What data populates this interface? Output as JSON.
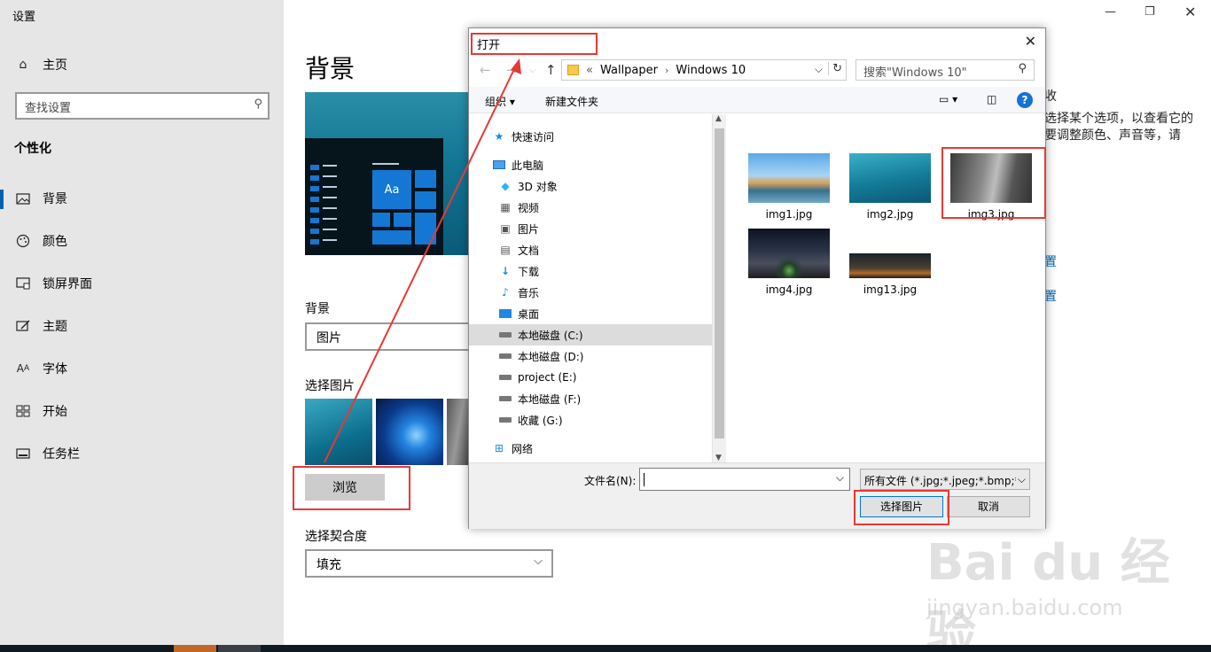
{
  "app_title": "设置",
  "sidebar": {
    "home": "主页",
    "search_placeholder": "查找设置",
    "category": "个性化",
    "items": [
      {
        "label": "背景",
        "icon": "image-icon"
      },
      {
        "label": "颜色",
        "icon": "palette-icon"
      },
      {
        "label": "锁屏界面",
        "icon": "lock-screen-icon"
      },
      {
        "label": "主题",
        "icon": "theme-icon"
      },
      {
        "label": "字体",
        "icon": "font-icon"
      },
      {
        "label": "开始",
        "icon": "start-icon"
      },
      {
        "label": "任务栏",
        "icon": "taskbar-icon"
      }
    ]
  },
  "main": {
    "title": "背景",
    "preview_tile_text": "Aa",
    "background_label": "背景",
    "background_value": "图片",
    "choose_picture_label": "选择图片",
    "browse_label": "浏览",
    "fit_label": "选择契合度",
    "fit_value": "填充",
    "right_text": [
      "收",
      "选择某个选项，以查看它的",
      "要调整颜色、声音等，请"
    ],
    "right_links": [
      "置",
      "置"
    ]
  },
  "dialog": {
    "title": "打开",
    "breadcrumb": [
      "«",
      "Wallpaper",
      "Windows 10"
    ],
    "search_placeholder": "搜索\"Windows 10\"",
    "toolbar": {
      "organize": "组织 ▾",
      "new_folder": "新建文件夹"
    },
    "tree": [
      {
        "label": "快速访问",
        "icon": "star-icon",
        "color": "#1e88e5"
      },
      {
        "label": "此电脑",
        "icon": "computer-icon",
        "color": "#1e88e5"
      },
      {
        "label": "3D 对象",
        "icon": "cube-icon",
        "color": "#29b6f6"
      },
      {
        "label": "视频",
        "icon": "video-icon",
        "color": "#555555"
      },
      {
        "label": "图片",
        "icon": "pictures-icon",
        "color": "#555555"
      },
      {
        "label": "文档",
        "icon": "document-icon",
        "color": "#555555"
      },
      {
        "label": "下载",
        "icon": "download-icon",
        "color": "#1e88e5"
      },
      {
        "label": "音乐",
        "icon": "music-icon",
        "color": "#1e88e5"
      },
      {
        "label": "桌面",
        "icon": "desktop-icon",
        "color": "#1e88e5"
      },
      {
        "label": "本地磁盘 (C:)",
        "icon": "drive-c-icon",
        "color": "#555555"
      },
      {
        "label": "本地磁盘 (D:)",
        "icon": "drive-icon",
        "color": "#555555"
      },
      {
        "label": "project (E:)",
        "icon": "drive-icon",
        "color": "#555555"
      },
      {
        "label": "本地磁盘 (F:)",
        "icon": "drive-icon",
        "color": "#555555"
      },
      {
        "label": "收藏 (G:)",
        "icon": "drive-icon",
        "color": "#555555"
      },
      {
        "label": "网络",
        "icon": "network-icon",
        "color": "#1e88e5"
      }
    ],
    "files": [
      "img1.jpg",
      "img2.jpg",
      "img3.jpg",
      "img4.jpg",
      "img13.jpg"
    ],
    "filename_label": "文件名(N):",
    "filename_value": "",
    "filetype": "所有文件 (*.jpg;*.jpeg;*.bmp;*.",
    "select_button": "选择图片",
    "cancel_button": "取消"
  },
  "watermark": {
    "logo": "Bai du 经验",
    "url": "jingyan.baidu.com"
  },
  "colors": {
    "accent": "#0063b1",
    "highlight": "#e53935"
  }
}
